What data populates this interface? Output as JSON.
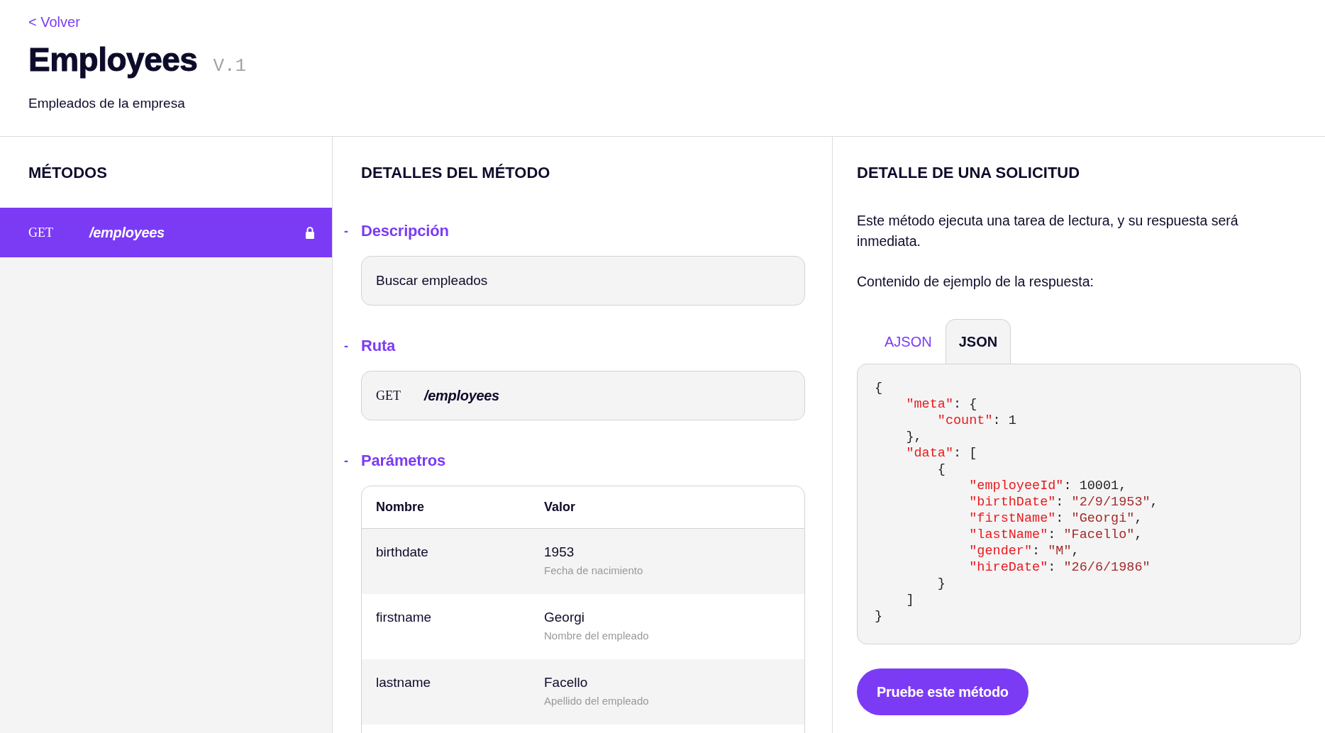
{
  "header": {
    "back_link": "< Volver",
    "title": "Employees",
    "version": "V.1",
    "subtitle": "Empleados de la empresa"
  },
  "methods": {
    "title": "MÉTODOS",
    "items": [
      {
        "method": "GET",
        "path": "/employees",
        "locked": true,
        "selected": true
      }
    ]
  },
  "details": {
    "title": "DETALLES DEL MÉTODO",
    "sections": [
      {
        "kind": "description",
        "toggle": "-",
        "heading": "Descripción",
        "text": "Buscar empleados"
      },
      {
        "kind": "route",
        "toggle": "-",
        "heading": "Ruta",
        "method": "GET",
        "path": "/employees"
      },
      {
        "kind": "params",
        "toggle": "-",
        "heading": "Parámetros",
        "columns": [
          "Nombre",
          "Valor"
        ],
        "rows": [
          {
            "name": "birthdate",
            "value": "1953",
            "hint": "Fecha de nacimiento"
          },
          {
            "name": "firstname",
            "value": "Georgi",
            "hint": "Nombre del empleado"
          },
          {
            "name": "lastname",
            "value": "Facello",
            "hint": "Apellido del empleado"
          }
        ]
      }
    ]
  },
  "request": {
    "title": "DETALLE DE UNA SOLICITUD",
    "description": "Este método ejecuta una tarea de lectura, y su respuesta será inmediata.",
    "example_label": "Contenido de ejemplo de la respuesta:",
    "tabs": [
      {
        "label": "AJSON",
        "selected": false
      },
      {
        "label": "JSON",
        "selected": true
      }
    ],
    "code_lines": [
      {
        "tokens": [
          {
            "kind": "plain",
            "text": "{"
          }
        ],
        "children": [
          {
            "tokens": [
              {
                "kind": "key",
                "text": "\"meta\""
              },
              {
                "kind": "plain",
                "text": ": {"
              }
            ],
            "children": [
              {
                "tokens": [
                  {
                    "kind": "key",
                    "text": "\"count\""
                  },
                  {
                    "kind": "plain",
                    "text": ": 1"
                  }
                ]
              }
            ]
          },
          {
            "tokens": [
              {
                "kind": "plain",
                "text": "},"
              }
            ]
          },
          {
            "tokens": [
              {
                "kind": "key",
                "text": "\"data\""
              },
              {
                "kind": "plain",
                "text": ": ["
              }
            ],
            "children": [
              {
                "tokens": [
                  {
                    "kind": "plain",
                    "text": "{"
                  }
                ],
                "children": [
                  {
                    "tokens": [
                      {
                        "kind": "key",
                        "text": "\"employeeId\""
                      },
                      {
                        "kind": "plain",
                        "text": ": 10001,"
                      }
                    ]
                  },
                  {
                    "tokens": [
                      {
                        "kind": "key",
                        "text": "\"birthDate\""
                      },
                      {
                        "kind": "plain",
                        "text": ": "
                      },
                      {
                        "kind": "string",
                        "text": "\"2/9/1953\""
                      },
                      {
                        "kind": "plain",
                        "text": ","
                      }
                    ]
                  },
                  {
                    "tokens": [
                      {
                        "kind": "key",
                        "text": "\"firstName\""
                      },
                      {
                        "kind": "plain",
                        "text": ": "
                      },
                      {
                        "kind": "string",
                        "text": "\"Georgi\""
                      },
                      {
                        "kind": "plain",
                        "text": ","
                      }
                    ]
                  },
                  {
                    "tokens": [
                      {
                        "kind": "key",
                        "text": "\"lastName\""
                      },
                      {
                        "kind": "plain",
                        "text": ": "
                      },
                      {
                        "kind": "string",
                        "text": "\"Facello\""
                      },
                      {
                        "kind": "plain",
                        "text": ","
                      }
                    ]
                  },
                  {
                    "tokens": [
                      {
                        "kind": "key",
                        "text": "\"gender\""
                      },
                      {
                        "kind": "plain",
                        "text": ": "
                      },
                      {
                        "kind": "string",
                        "text": "\"M\""
                      },
                      {
                        "kind": "plain",
                        "text": ","
                      }
                    ]
                  },
                  {
                    "tokens": [
                      {
                        "kind": "key",
                        "text": "\"hireDate\""
                      },
                      {
                        "kind": "plain",
                        "text": ": "
                      },
                      {
                        "kind": "string",
                        "text": "\"26/6/1986\""
                      }
                    ]
                  }
                ]
              },
              {
                "tokens": [
                  {
                    "kind": "plain",
                    "text": "}"
                  }
                ]
              }
            ]
          },
          {
            "tokens": [
              {
                "kind": "plain",
                "text": "]"
              }
            ]
          }
        ]
      },
      {
        "tokens": [
          {
            "kind": "plain",
            "text": "}"
          }
        ]
      }
    ],
    "button": "Pruebe este método"
  }
}
